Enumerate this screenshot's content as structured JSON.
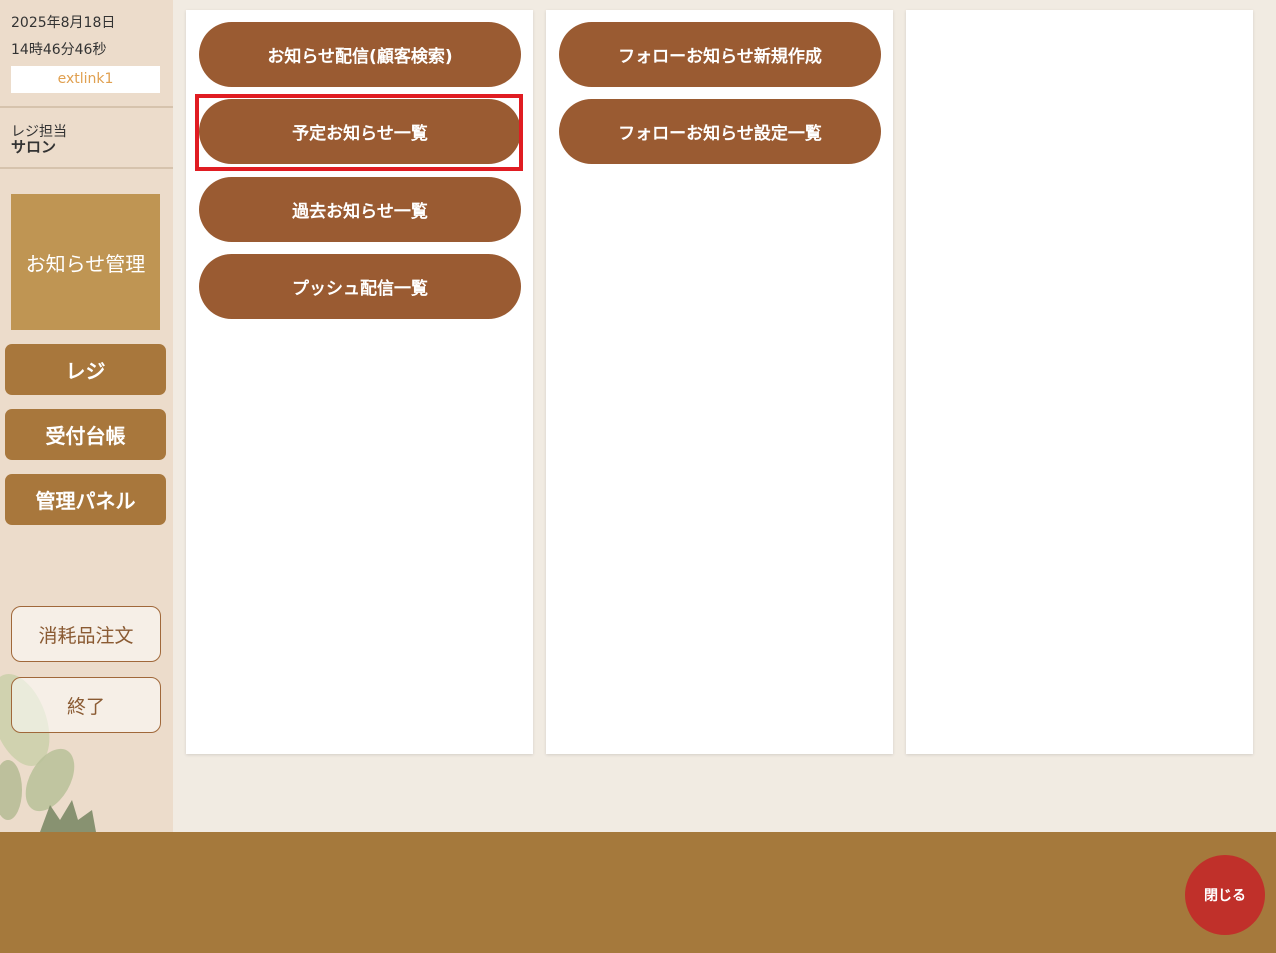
{
  "sidebar": {
    "date": "2025年8月18日",
    "time": "14時46分46秒",
    "user": "extlink1",
    "staff_label": "レジ担当",
    "staff_name": "サロン",
    "current_menu": "お知らせ管理",
    "nav": [
      {
        "label": "レジ"
      },
      {
        "label": "受付台帳"
      },
      {
        "label": "管理パネル"
      }
    ],
    "order_label": "消耗品注文",
    "exit_label": "終了"
  },
  "panels": {
    "left": [
      {
        "label": "お知らせ配信(顧客検索)"
      },
      {
        "label": "予定お知らせ一覧"
      },
      {
        "label": "過去お知らせ一覧"
      },
      {
        "label": "プッシュ配信一覧"
      }
    ],
    "middle": [
      {
        "label": "フォローお知らせ新規作成"
      },
      {
        "label": "フォローお知らせ設定一覧"
      }
    ]
  },
  "footer": {
    "close_label": "閉じる"
  },
  "colors": {
    "pill": "#9a5b32",
    "nav": "#a8773c",
    "footer": "#a5793c",
    "highlight": "#e01c22",
    "close": "#c0302a"
  }
}
